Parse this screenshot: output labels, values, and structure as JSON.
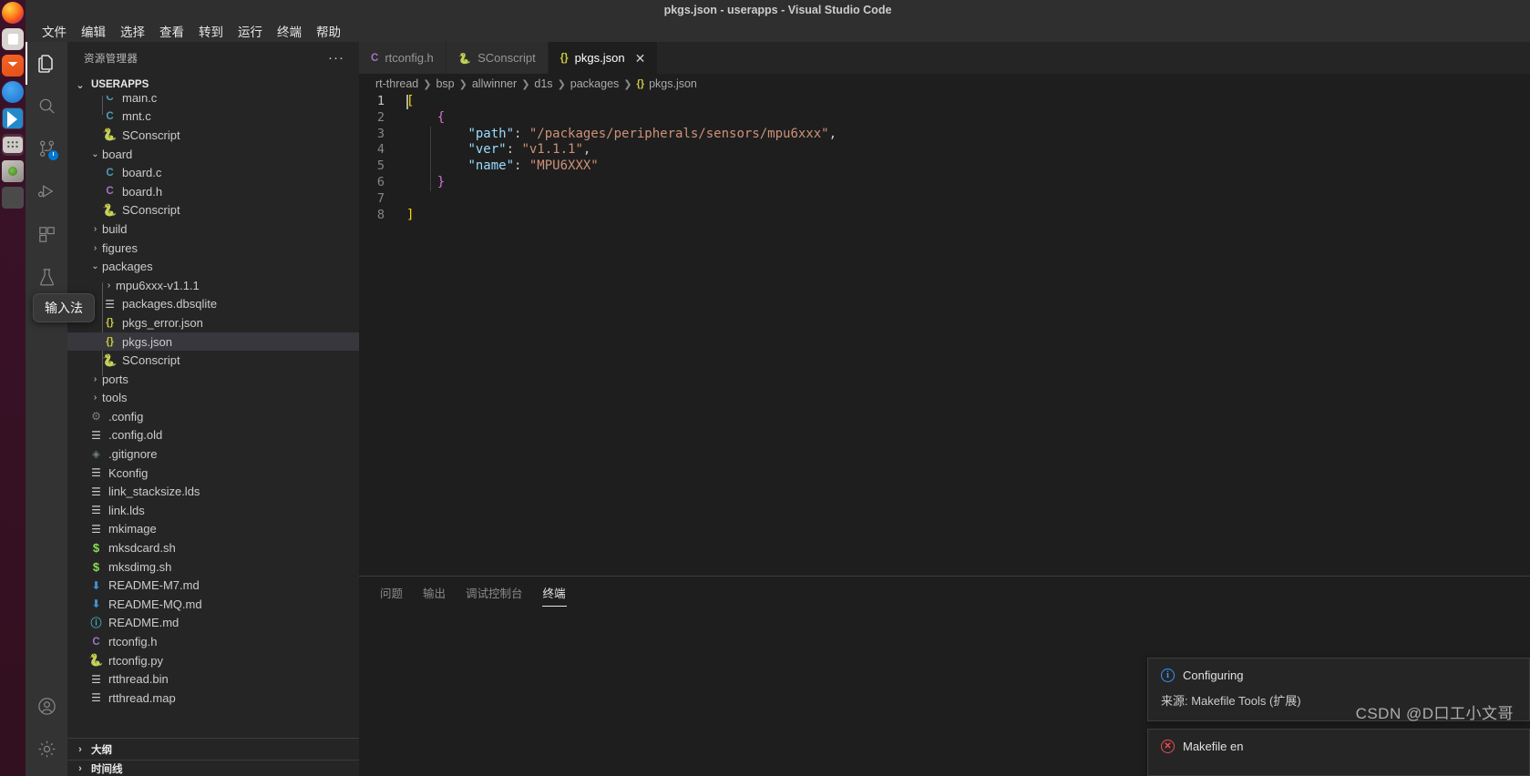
{
  "window": {
    "title": "pkgs.json - userapps - Visual Studio Code"
  },
  "menubar": {
    "items": [
      {
        "label": "文件",
        "name": "menu-file"
      },
      {
        "label": "编辑",
        "name": "menu-edit"
      },
      {
        "label": "选择",
        "name": "menu-selection"
      },
      {
        "label": "查看",
        "name": "menu-view"
      },
      {
        "label": "转到",
        "name": "menu-go"
      },
      {
        "label": "运行",
        "name": "menu-run"
      },
      {
        "label": "终端",
        "name": "menu-terminal"
      },
      {
        "label": "帮助",
        "name": "menu-help"
      }
    ]
  },
  "dock": {
    "items": [
      {
        "name": "dock-item-firefox",
        "icon": "firefox-icon"
      },
      {
        "name": "dock-item-files",
        "icon": "files-icon"
      },
      {
        "name": "dock-item-mail",
        "icon": "mail-icon"
      },
      {
        "name": "dock-item-thunderbird",
        "icon": "thunderbird-icon"
      },
      {
        "name": "dock-item-vscode",
        "icon": "vscode-icon"
      },
      {
        "name": "dock-item-calculator",
        "icon": "calculator-icon"
      },
      {
        "name": "dock-item-disk",
        "icon": "disk-icon"
      },
      {
        "name": "dock-item-other",
        "icon": "app-icon"
      }
    ]
  },
  "activitybar": {
    "items": [
      {
        "name": "activity-explorer",
        "icon": "files-icon",
        "selected": true
      },
      {
        "name": "activity-search",
        "icon": "search-icon",
        "selected": false
      },
      {
        "name": "activity-source-control",
        "icon": "source-control-icon",
        "selected": false,
        "badge": "clock-badge"
      },
      {
        "name": "activity-run-debug",
        "icon": "run-debug-icon",
        "selected": false
      },
      {
        "name": "activity-extensions",
        "icon": "extensions-icon",
        "selected": false
      },
      {
        "name": "activity-testing",
        "icon": "beaker-icon",
        "selected": false
      }
    ],
    "bottom": [
      {
        "name": "activity-account",
        "icon": "account-icon"
      },
      {
        "name": "activity-settings",
        "icon": "gear-icon"
      }
    ]
  },
  "ime_tooltip": {
    "label": "输入法"
  },
  "sidebar": {
    "header": {
      "title": "资源管理器",
      "more_actions": "···"
    },
    "root_section": {
      "label": "USERAPPS",
      "expanded": true
    },
    "tree": [
      {
        "label": "main.c",
        "indent": 2,
        "icon": "c-file-icon",
        "kind": "file",
        "partial": true
      },
      {
        "label": "mnt.c",
        "indent": 2,
        "icon": "c-file-icon",
        "kind": "file"
      },
      {
        "label": "SConscript",
        "indent": 2,
        "icon": "python-file-icon",
        "kind": "file"
      },
      {
        "label": "board",
        "indent": 1,
        "icon": "chevron-down-icon",
        "kind": "folder",
        "expanded": true
      },
      {
        "label": "board.c",
        "indent": 2,
        "icon": "c-file-icon",
        "kind": "file"
      },
      {
        "label": "board.h",
        "indent": 2,
        "icon": "h-file-icon",
        "kind": "file"
      },
      {
        "label": "SConscript",
        "indent": 2,
        "icon": "python-file-icon",
        "kind": "file"
      },
      {
        "label": "build",
        "indent": 1,
        "icon": "chevron-right-icon",
        "kind": "folder",
        "expanded": false
      },
      {
        "label": "figures",
        "indent": 1,
        "icon": "chevron-right-icon",
        "kind": "folder",
        "expanded": false
      },
      {
        "label": "packages",
        "indent": 1,
        "icon": "chevron-down-icon",
        "kind": "folder",
        "expanded": true
      },
      {
        "label": "mpu6xxx-v1.1.1",
        "indent": 2,
        "icon": "chevron-right-icon",
        "kind": "folder",
        "expanded": false
      },
      {
        "label": "packages.dbsqlite",
        "indent": 2,
        "icon": "text-file-icon",
        "kind": "file"
      },
      {
        "label": "pkgs_error.json",
        "indent": 2,
        "icon": "json-file-icon",
        "kind": "file"
      },
      {
        "label": "pkgs.json",
        "indent": 2,
        "icon": "json-file-icon",
        "kind": "file",
        "selected": true
      },
      {
        "label": "SConscript",
        "indent": 2,
        "icon": "python-file-icon",
        "kind": "file"
      },
      {
        "label": "ports",
        "indent": 1,
        "icon": "chevron-right-icon",
        "kind": "folder",
        "expanded": false
      },
      {
        "label": "tools",
        "indent": 1,
        "icon": "chevron-right-icon",
        "kind": "folder",
        "expanded": false
      },
      {
        "label": ".config",
        "indent": 1,
        "icon": "gear-file-icon",
        "kind": "file"
      },
      {
        "label": ".config.old",
        "indent": 1,
        "icon": "text-file-icon",
        "kind": "file"
      },
      {
        "label": ".gitignore",
        "indent": 1,
        "icon": "git-file-icon",
        "kind": "file"
      },
      {
        "label": "Kconfig",
        "indent": 1,
        "icon": "text-file-icon",
        "kind": "file"
      },
      {
        "label": "link_stacksize.lds",
        "indent": 1,
        "icon": "text-file-icon",
        "kind": "file"
      },
      {
        "label": "link.lds",
        "indent": 1,
        "icon": "text-file-icon",
        "kind": "file"
      },
      {
        "label": "mkimage",
        "indent": 1,
        "icon": "text-file-icon",
        "kind": "file"
      },
      {
        "label": "mksdcard.sh",
        "indent": 1,
        "icon": "shell-file-icon",
        "kind": "file"
      },
      {
        "label": "mksdimg.sh",
        "indent": 1,
        "icon": "shell-file-icon",
        "kind": "file"
      },
      {
        "label": "README-M7.md",
        "indent": 1,
        "icon": "markdown-file-icon",
        "kind": "file"
      },
      {
        "label": "README-MQ.md",
        "indent": 1,
        "icon": "markdown-file-icon",
        "kind": "file"
      },
      {
        "label": "README.md",
        "indent": 1,
        "icon": "info-file-icon",
        "kind": "file"
      },
      {
        "label": "rtconfig.h",
        "indent": 1,
        "icon": "h-file-icon",
        "kind": "file"
      },
      {
        "label": "rtconfig.py",
        "indent": 1,
        "icon": "python-file-icon",
        "kind": "file"
      },
      {
        "label": "rtthread.bin",
        "indent": 1,
        "icon": "text-file-icon",
        "kind": "file"
      },
      {
        "label": "rtthread.map",
        "indent": 1,
        "icon": "text-file-icon",
        "kind": "file"
      }
    ],
    "outline_section": {
      "label": "大纲",
      "expanded": false
    },
    "timeline_section": {
      "label": "时间线",
      "expanded": false
    }
  },
  "editor": {
    "tabs": [
      {
        "label": "rtconfig.h",
        "icon": "h-file-icon",
        "active": false,
        "name": "tab-rtconfig-h"
      },
      {
        "label": "SConscript",
        "icon": "python-file-icon",
        "active": false,
        "name": "tab-sconscript"
      },
      {
        "label": "pkgs.json",
        "icon": "json-file-icon",
        "active": true,
        "name": "tab-pkgs-json",
        "close": "✕"
      }
    ],
    "breadcrumb": [
      "rt-thread",
      "bsp",
      "allwinner",
      "d1s",
      "packages",
      "pkgs.json"
    ],
    "breadcrumb_file_icon": "{}",
    "lines": [
      {
        "n": "1",
        "indent": 0,
        "tokens": [
          {
            "t": "[",
            "c": "punct"
          }
        ]
      },
      {
        "n": "2",
        "indent": 1,
        "tokens": [
          {
            "t": "{",
            "c": "brace"
          }
        ]
      },
      {
        "n": "3",
        "indent": 2,
        "tokens": [
          {
            "t": "\"path\"",
            "c": "key"
          },
          {
            "t": ": ",
            "c": "colon"
          },
          {
            "t": "\"/packages/peripherals/sensors/mpu6xxx\"",
            "c": "str"
          },
          {
            "t": ",",
            "c": "colon"
          }
        ]
      },
      {
        "n": "4",
        "indent": 2,
        "tokens": [
          {
            "t": "\"ver\"",
            "c": "key"
          },
          {
            "t": ": ",
            "c": "colon"
          },
          {
            "t": "\"v1.1.1\"",
            "c": "str"
          },
          {
            "t": ",",
            "c": "colon"
          }
        ]
      },
      {
        "n": "5",
        "indent": 2,
        "tokens": [
          {
            "t": "\"name\"",
            "c": "key"
          },
          {
            "t": ": ",
            "c": "colon"
          },
          {
            "t": "\"MPU6XXX\"",
            "c": "str"
          }
        ]
      },
      {
        "n": "6",
        "indent": 1,
        "tokens": [
          {
            "t": "}",
            "c": "brace"
          }
        ]
      },
      {
        "n": "7",
        "indent": 0,
        "tokens": []
      },
      {
        "n": "8",
        "indent": 0,
        "tokens": [
          {
            "t": "]",
            "c": "punct"
          }
        ]
      }
    ]
  },
  "panel": {
    "tabs": [
      {
        "label": "问题",
        "active": false,
        "name": "panel-tab-problems"
      },
      {
        "label": "输出",
        "active": false,
        "name": "panel-tab-output"
      },
      {
        "label": "调试控制台",
        "active": false,
        "name": "panel-tab-debug-console"
      },
      {
        "label": "终端",
        "active": true,
        "name": "panel-tab-terminal"
      }
    ]
  },
  "notifications": [
    {
      "icon": "info-icon",
      "title": "Configuring",
      "source": "来源: Makefile Tools (扩展)",
      "name": "notification-configuring"
    },
    {
      "icon": "error-icon",
      "title": "Makefile en",
      "source": "",
      "name": "notification-makefile-error"
    }
  ],
  "watermark": {
    "text": "CSDN @D口工小文哥"
  },
  "colors": {
    "accent_blue": "#3794ff",
    "error_red": "#f14c4c",
    "json_yellow": "#cbcb41",
    "selection_bg": "#37373d"
  }
}
